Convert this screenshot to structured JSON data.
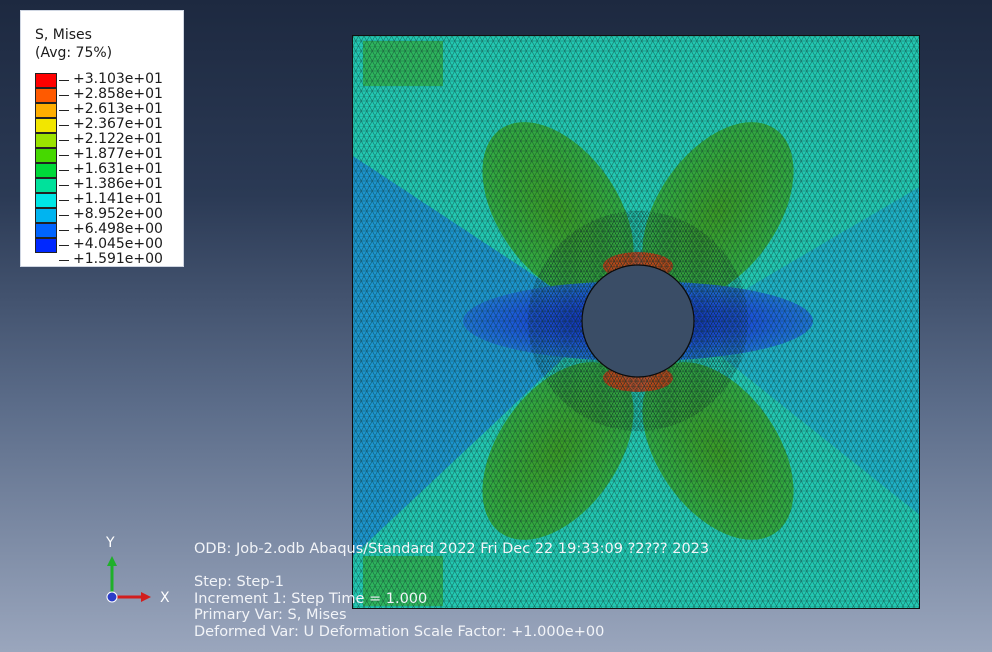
{
  "legend": {
    "title": "S, Mises",
    "subtitle": "(Avg: 75%)",
    "entries": [
      {
        "label": "+3.103e+01",
        "color": "#ff0000"
      },
      {
        "label": "+2.858e+01",
        "color": "#ff5a00"
      },
      {
        "label": "+2.613e+01",
        "color": "#ffae00"
      },
      {
        "label": "+2.367e+01",
        "color": "#f2e600"
      },
      {
        "label": "+2.122e+01",
        "color": "#9be300"
      },
      {
        "label": "+1.877e+01",
        "color": "#46d800"
      },
      {
        "label": "+1.631e+01",
        "color": "#00d83a"
      },
      {
        "label": "+1.386e+01",
        "color": "#00e19b"
      },
      {
        "label": "+1.141e+01",
        "color": "#00e6e6"
      },
      {
        "label": "+8.952e+00",
        "color": "#00b4f0"
      },
      {
        "label": "+6.498e+00",
        "color": "#0064ff"
      },
      {
        "label": "+4.045e+00",
        "color": "#0028ff"
      },
      {
        "label": "+1.591e+00",
        "color": ""
      }
    ]
  },
  "info": {
    "odb_line": "ODB: Job-2.odb    Abaqus/Standard 2022    Fri Dec 22 19:33:09 ?2??? 2023",
    "step_line": "Step: Step-1",
    "increment_line": "Increment       1: Step Time =     1.000",
    "primary_var_line": "Primary Var: S, Mises",
    "deformed_var_line": "Deformed Var: U   Deformation Scale Factor: +1.000e+00"
  },
  "triad": {
    "y_label": "Y",
    "x_label": "X",
    "y_color": "#1fb02a",
    "x_color": "#d21e1e",
    "z_color": "#2a3cc8"
  },
  "colors": {
    "mesh_line": "#0d2a26",
    "plate_base": "#22c8b2",
    "hole": "#3a4d66"
  }
}
